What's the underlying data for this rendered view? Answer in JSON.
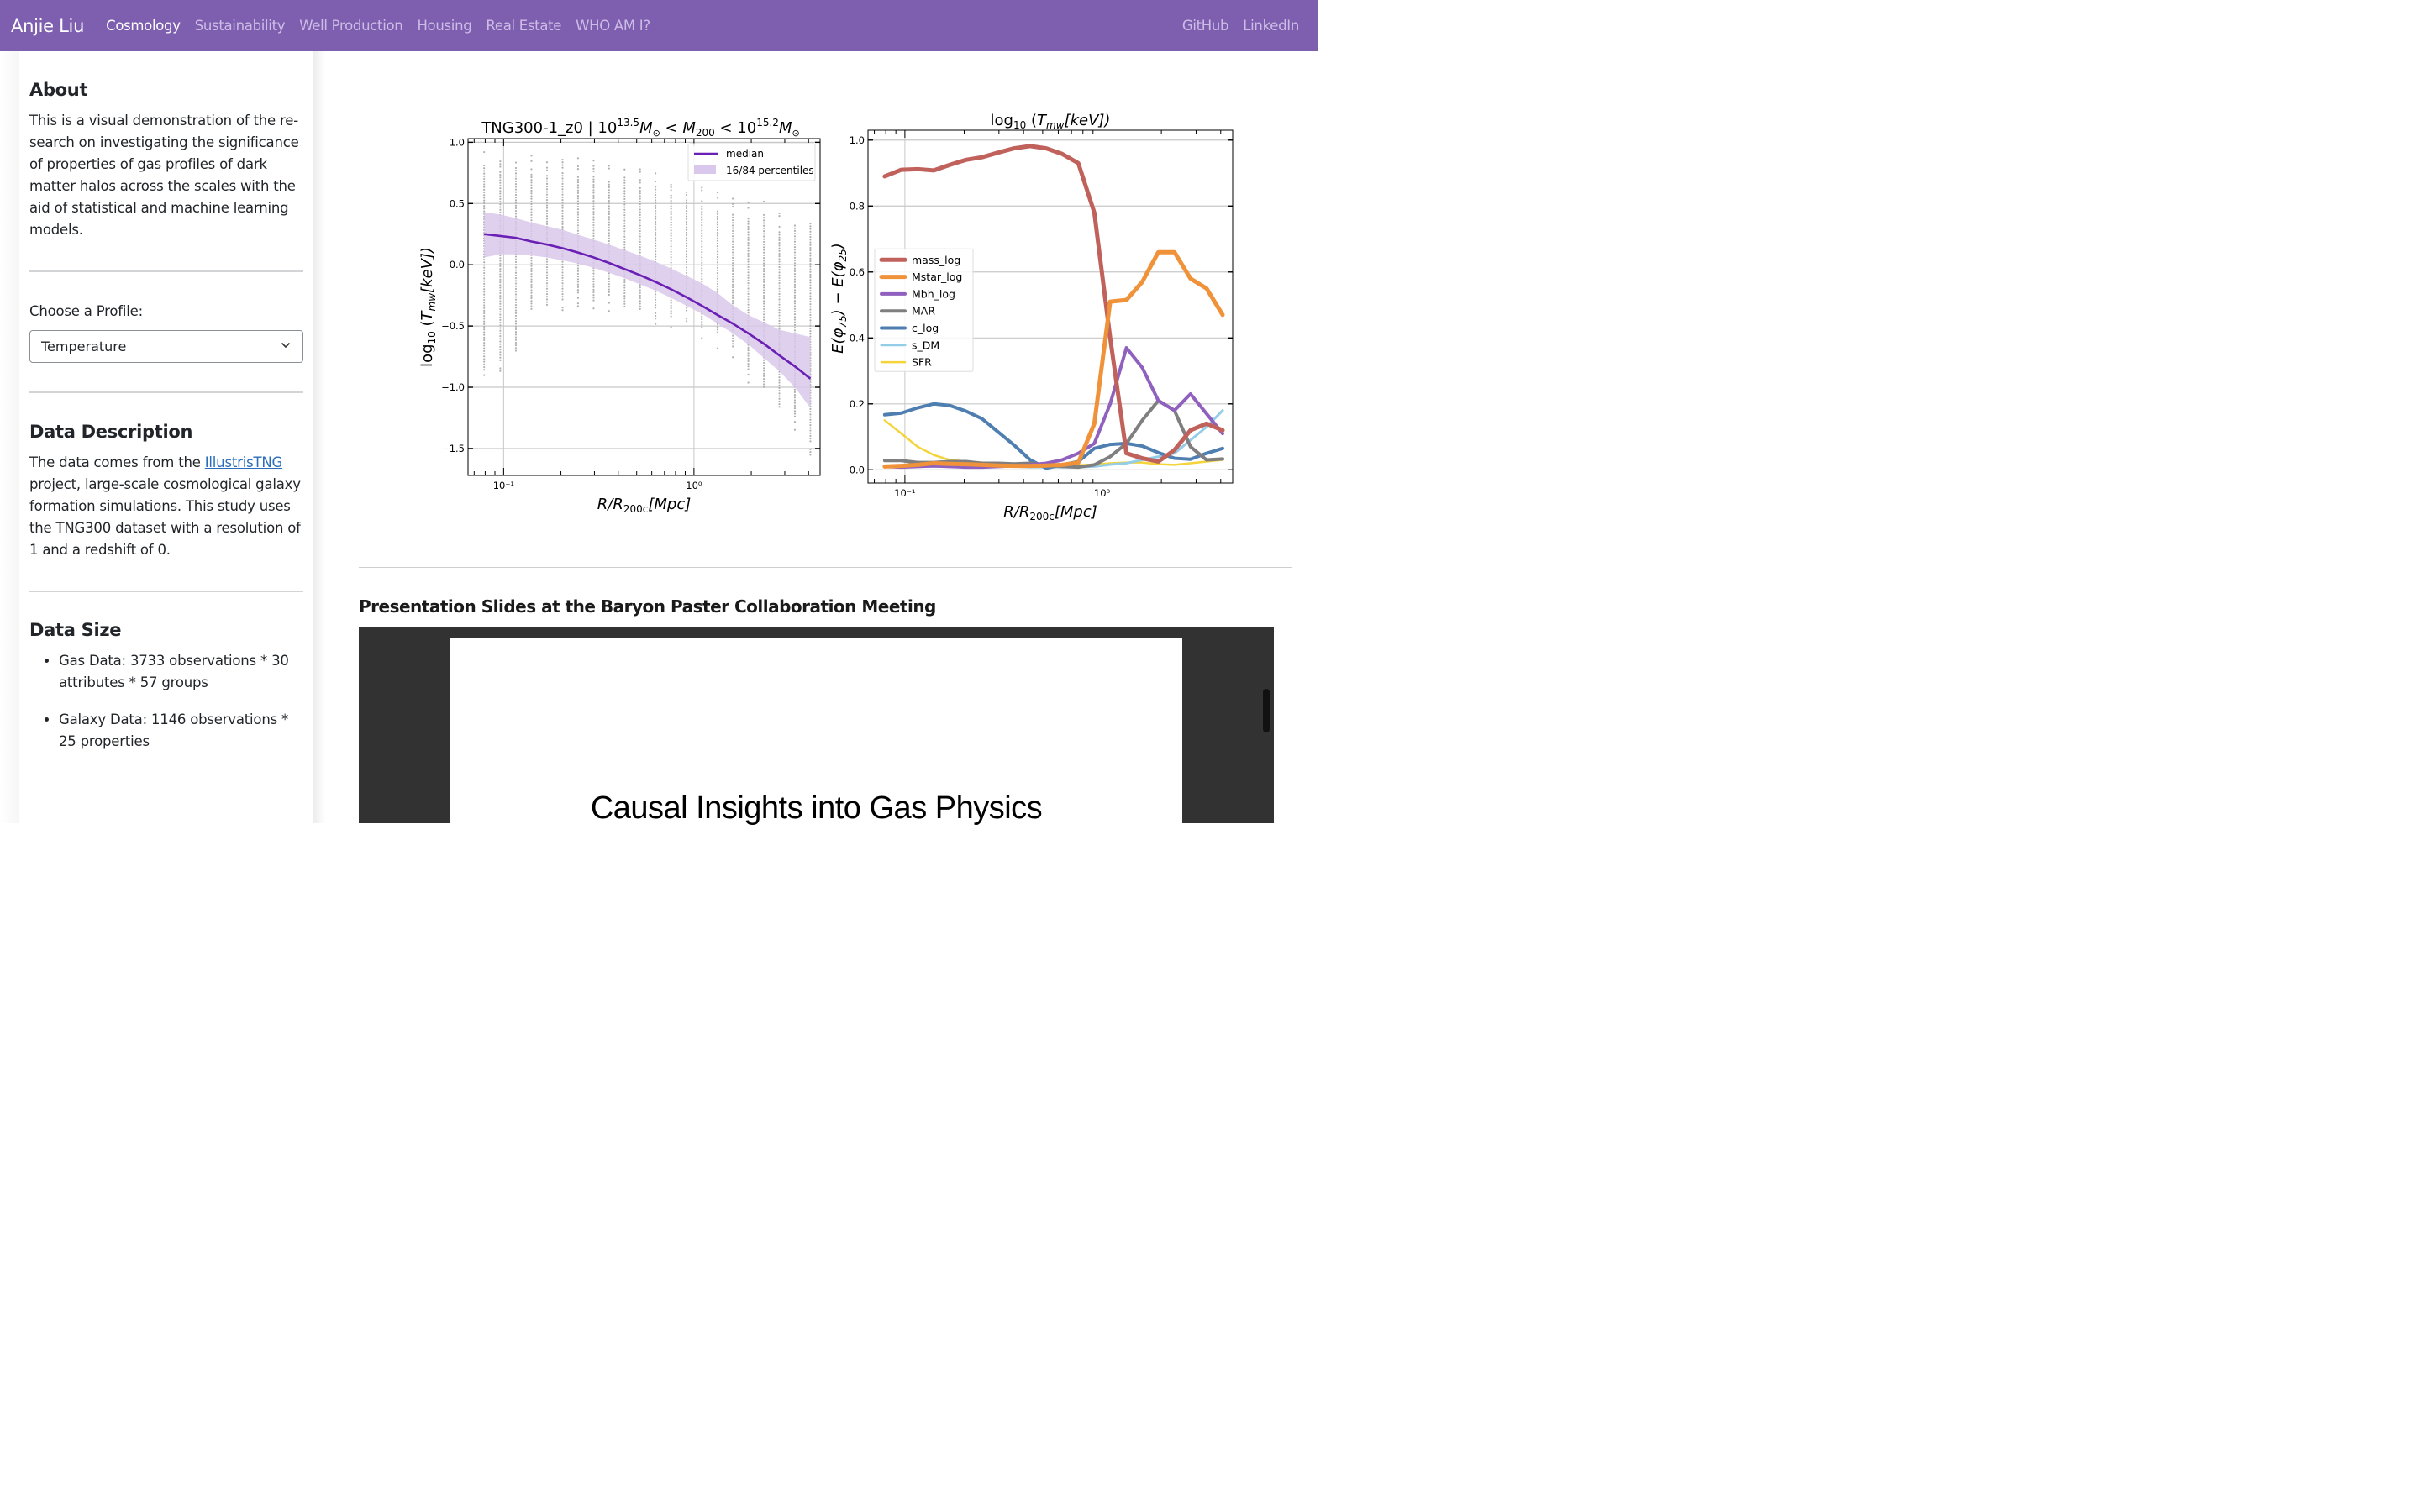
{
  "navbar": {
    "brand": "Anjie Liu",
    "items": [
      {
        "label": "Cosmology",
        "active": true
      },
      {
        "label": "Sustainability",
        "active": false
      },
      {
        "label": "Well Production",
        "active": false
      },
      {
        "label": "Housing",
        "active": false
      },
      {
        "label": "Real Estate",
        "active": false
      },
      {
        "label": "WHO AM I?",
        "active": false
      }
    ],
    "right_items": [
      {
        "label": "GitHub"
      },
      {
        "label": "LinkedIn"
      }
    ],
    "colors": {
      "background": "#7e5eaf",
      "active": "#ffffff",
      "inactive": "#cdbde6"
    }
  },
  "sidebar": {
    "about": {
      "heading": "About",
      "text": "This is a visual demonstration of the re-search on investigating the significance of properties of gas profiles of dark matter halos across the scales with the aid of statistical and machine learning models."
    },
    "profile_select": {
      "label": "Choose a Profile:",
      "value": "Temperature"
    },
    "data_description": {
      "heading": "Data Description",
      "text_before_link": "The data comes from the ",
      "link_text": "IllustrisTNG",
      "text_after_link": " project, large-scale cosmological galaxy formation simulations. This study uses the TNG300 dataset with a resolution of 1 and a redshift of 0."
    },
    "data_size": {
      "heading": "Data Size",
      "items": [
        "Gas Data: 3733 observations * 30 attributes * 57 groups",
        "Galaxy Data: 1146 observations * 25 properties"
      ]
    }
  },
  "slides": {
    "heading": "Presentation Slides at the Baryon Paster Collaboration Meeting",
    "slide_title": "Causal Insights into Gas Physics"
  },
  "chart_data": [
    {
      "type": "scatter",
      "title": "TNG300-1_z0 | 10^13.5 M⊙ < M200 < 10^15.2 M⊙",
      "title_parts": {
        "prefix": "TNG300-1_z0 | 10",
        "exp1": "13.5",
        "mid": "M",
        "sun": "⊙",
        "lt": " < M",
        "sub": "200",
        "lt2": " < 10",
        "exp2": "15.2"
      },
      "xlabel": "R/R200c[Mpc]",
      "ylabel": "log10 (Tmw[keV])",
      "xscale": "log",
      "xlim": [
        0.065,
        4.6
      ],
      "ylim": [
        -1.72,
        1.03
      ],
      "xticks": [
        {
          "value": 0.1,
          "label": "10⁻¹"
        },
        {
          "value": 1,
          "label": "10⁰"
        }
      ],
      "yticks": [
        1.0,
        0.5,
        0.0,
        -0.5,
        -1.0,
        -1.5
      ],
      "ytick_labels": [
        "1.0",
        "0.5",
        "0.0",
        "−0.5",
        "−1.0",
        "−1.5"
      ],
      "grid": true,
      "legend": {
        "position": "top-right",
        "entries": [
          "median",
          "16/84 percentiles"
        ]
      },
      "x": [
        0.079,
        0.096,
        0.116,
        0.14,
        0.169,
        0.204,
        0.246,
        0.297,
        0.358,
        0.432,
        0.521,
        0.628,
        0.758,
        0.914,
        1.1,
        1.33,
        1.6,
        1.93,
        2.33,
        2.81,
        3.39,
        4.09
      ],
      "series": [
        {
          "name": "median",
          "color": "#6a1fb5",
          "values": [
            0.25,
            0.235,
            0.22,
            0.19,
            0.165,
            0.135,
            0.1,
            0.06,
            0.015,
            -0.035,
            -0.085,
            -0.14,
            -0.2,
            -0.265,
            -0.335,
            -0.41,
            -0.48,
            -0.56,
            -0.645,
            -0.74,
            -0.83,
            -0.93
          ]
        },
        {
          "name": "16/84 percentiles",
          "color": "#d9c8eb",
          "lower": [
            0.06,
            0.085,
            0.085,
            0.075,
            0.06,
            0.035,
            0.01,
            -0.025,
            -0.065,
            -0.11,
            -0.16,
            -0.21,
            -0.27,
            -0.335,
            -0.4,
            -0.48,
            -0.56,
            -0.65,
            -0.76,
            -0.87,
            -1.0,
            -1.17
          ],
          "upper": [
            0.43,
            0.41,
            0.38,
            0.345,
            0.315,
            0.285,
            0.245,
            0.205,
            0.165,
            0.12,
            0.075,
            0.025,
            -0.03,
            -0.09,
            -0.15,
            -0.23,
            -0.33,
            -0.41,
            -0.47,
            -0.53,
            -0.56,
            -0.59
          ]
        }
      ],
      "scatter_columns": {
        "color": "#b0b0b0",
        "top": [
          0.92,
          0.91,
          0.9,
          0.89,
          0.88,
          0.88,
          0.87,
          0.85,
          0.83,
          0.8,
          0.78,
          0.79,
          0.72,
          0.68,
          0.63,
          0.59,
          0.54,
          0.53,
          0.56,
          0.42,
          0.43,
          0.49
        ],
        "bottom": [
          -0.92,
          -0.88,
          -0.78,
          -0.49,
          -0.45,
          -0.38,
          -0.36,
          -0.36,
          -0.38,
          -0.42,
          -0.47,
          -0.49,
          -0.54,
          -0.5,
          -0.61,
          -0.69,
          -0.8,
          -0.97,
          -1.12,
          -1.22,
          -1.36,
          -1.58
        ]
      }
    },
    {
      "type": "line",
      "title": "log10 (Tmw[keV])",
      "xlabel": "R/R200c[Mpc]",
      "ylabel": "E(φ75) − E(φ25)",
      "xscale": "log",
      "xlim": [
        0.065,
        4.6
      ],
      "ylim": [
        -0.04,
        1.03
      ],
      "xticks": [
        {
          "value": 0.1,
          "label": "10⁻¹"
        },
        {
          "value": 1,
          "label": "10⁰"
        }
      ],
      "yticks": [
        0.0,
        0.2,
        0.4,
        0.6,
        0.8,
        1.0
      ],
      "ytick_labels": [
        "0.0",
        "0.2",
        "0.4",
        "0.6",
        "0.8",
        "1.0"
      ],
      "grid": true,
      "legend": {
        "position": "center-left",
        "entries": [
          "mass_log",
          "Mstar_log",
          "Mbh_log",
          "MAR",
          "c_log",
          "s_DM",
          "SFR"
        ]
      },
      "x": [
        0.079,
        0.096,
        0.116,
        0.14,
        0.169,
        0.204,
        0.246,
        0.297,
        0.358,
        0.432,
        0.521,
        0.628,
        0.758,
        0.914,
        1.1,
        1.33,
        1.6,
        1.93,
        2.33,
        2.81,
        3.39,
        4.09
      ],
      "series": [
        {
          "name": "mass_log",
          "color": "#c0615c",
          "width": 5,
          "values": [
            0.89,
            0.91,
            0.912,
            0.908,
            0.925,
            0.94,
            0.948,
            0.962,
            0.975,
            0.982,
            0.975,
            0.958,
            0.93,
            0.78,
            0.4,
            0.05,
            0.035,
            0.025,
            0.06,
            0.12,
            0.14,
            0.12
          ]
        },
        {
          "name": "Mstar_log",
          "color": "#f0923a",
          "width": 5,
          "values": [
            0.01,
            0.012,
            0.015,
            0.02,
            0.018,
            0.017,
            0.015,
            0.013,
            0.012,
            0.012,
            0.013,
            0.015,
            0.022,
            0.14,
            0.51,
            0.515,
            0.57,
            0.66,
            0.66,
            0.58,
            0.55,
            0.47
          ]
        },
        {
          "name": "Mbh_log",
          "color": "#9060bf",
          "width": 4,
          "values": [
            0.01,
            0.008,
            0.01,
            0.012,
            0.01,
            0.008,
            0.008,
            0.01,
            0.012,
            0.015,
            0.02,
            0.03,
            0.05,
            0.08,
            0.2,
            0.37,
            0.31,
            0.21,
            0.18,
            0.23,
            0.17,
            0.11
          ]
        },
        {
          "name": "MAR",
          "color": "#7f7f7f",
          "width": 4,
          "values": [
            0.028,
            0.028,
            0.022,
            0.022,
            0.025,
            0.025,
            0.02,
            0.02,
            0.018,
            0.02,
            0.015,
            0.01,
            0.008,
            0.015,
            0.04,
            0.08,
            0.15,
            0.21,
            0.18,
            0.07,
            0.03,
            0.033
          ]
        },
        {
          "name": "c_log",
          "color": "#4f7fb0",
          "width": 4,
          "values": [
            0.167,
            0.172,
            0.188,
            0.2,
            0.195,
            0.178,
            0.155,
            0.115,
            0.075,
            0.03,
            0.005,
            0.015,
            0.025,
            0.065,
            0.077,
            0.08,
            0.072,
            0.052,
            0.035,
            0.032,
            0.05,
            0.065
          ]
        },
        {
          "name": "s_DM",
          "color": "#93cde8",
          "width": 3,
          "values": [
            0.01,
            0.01,
            0.01,
            0.01,
            0.01,
            0.01,
            0.01,
            0.01,
            0.01,
            0.008,
            0.008,
            0.008,
            0.008,
            0.01,
            0.016,
            0.02,
            0.03,
            0.04,
            0.05,
            0.09,
            0.13,
            0.18
          ]
        },
        {
          "name": "SFR",
          "color": "#f4d43a",
          "width": 2.5,
          "values": [
            0.15,
            0.11,
            0.07,
            0.045,
            0.03,
            0.025,
            0.022,
            0.02,
            0.018,
            0.018,
            0.016,
            0.016,
            0.014,
            0.016,
            0.02,
            0.022,
            0.022,
            0.017,
            0.015,
            0.02,
            0.025,
            0.03
          ]
        }
      ]
    }
  ]
}
